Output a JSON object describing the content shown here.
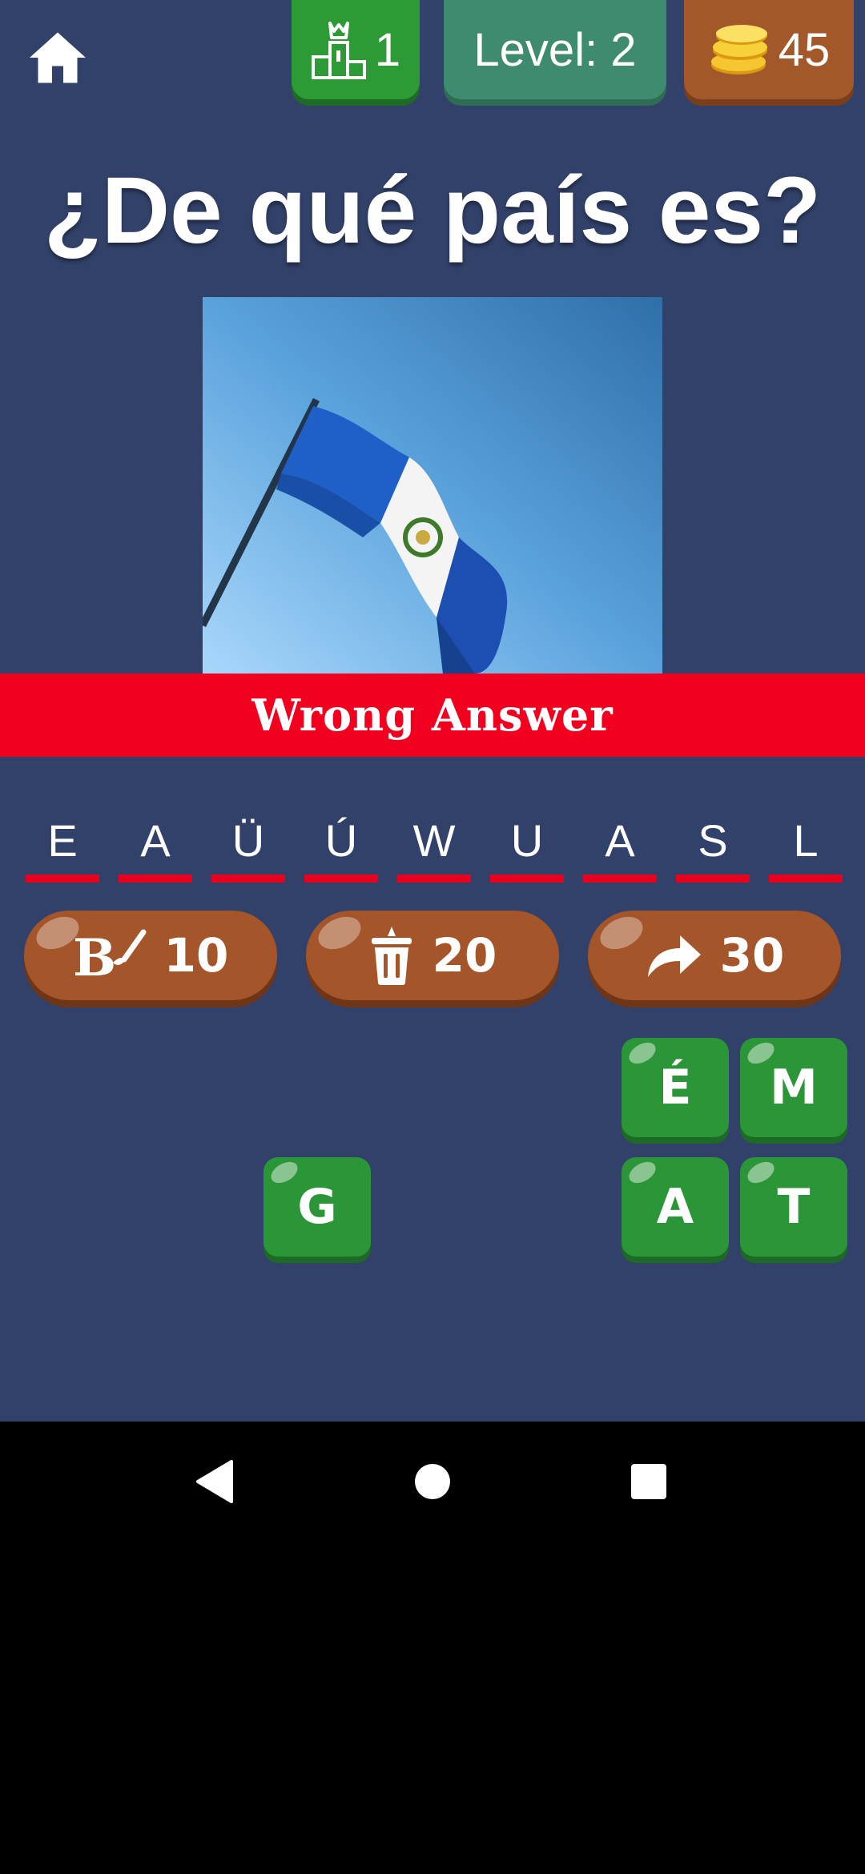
{
  "topbar": {
    "rank_value": "1",
    "level_text": "Level: 2",
    "coins_value": "45"
  },
  "question": "¿De qué país es?",
  "feedback": "Wrong Answer",
  "answer_slots": [
    "E",
    "A",
    "Ü",
    "Ú",
    "W",
    "U",
    "A",
    "S",
    "L"
  ],
  "powerups": [
    {
      "icon": "paint-brush-letter-icon",
      "cost": "10"
    },
    {
      "icon": "trash-can-icon",
      "cost": "20"
    },
    {
      "icon": "skip-arrow-icon",
      "cost": "30"
    }
  ],
  "tiles": {
    "e_acute": "É",
    "m": "M",
    "g": "G",
    "a": "A",
    "t": "T"
  },
  "colors": {
    "background": "#324169",
    "banner": "#f2001f",
    "tile_green": "#2b9637",
    "powerup_brown": "#a5552a"
  }
}
